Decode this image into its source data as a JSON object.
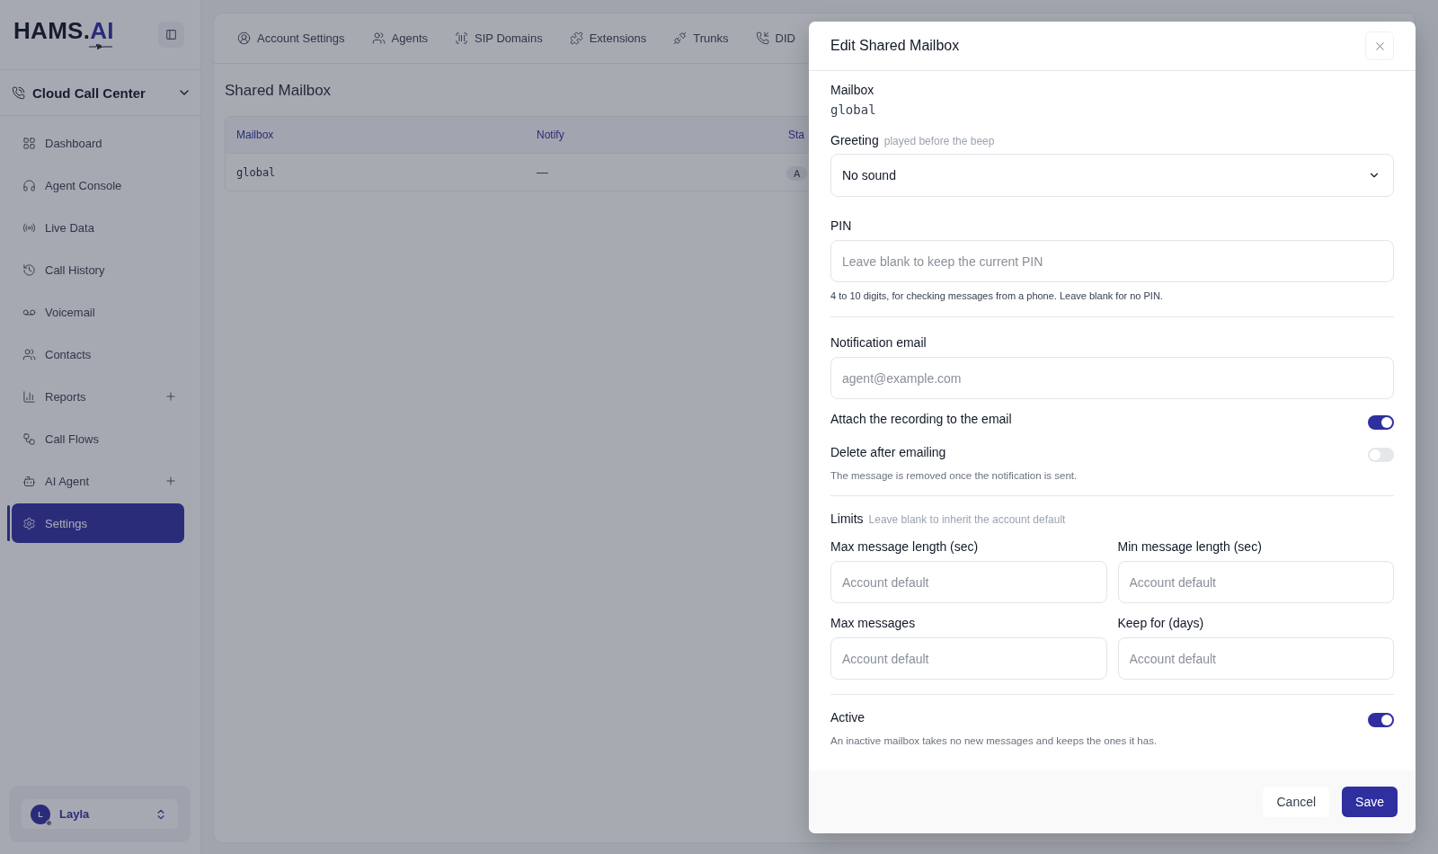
{
  "sidebar": {
    "logo": {
      "text": "HAMS.",
      "accent": "AI"
    },
    "workspace": "Cloud Call Center",
    "items": [
      {
        "label": "Dashboard",
        "selected": false,
        "addable": false
      },
      {
        "label": "Agent Console",
        "selected": false,
        "addable": false
      },
      {
        "label": "Live Data",
        "selected": false,
        "addable": false
      },
      {
        "label": "Call History",
        "selected": false,
        "addable": false
      },
      {
        "label": "Voicemail",
        "selected": false,
        "addable": false
      },
      {
        "label": "Contacts",
        "selected": false,
        "addable": false
      },
      {
        "label": "Reports",
        "selected": false,
        "addable": true
      },
      {
        "label": "Call Flows",
        "selected": false,
        "addable": false
      },
      {
        "label": "AI Agent",
        "selected": false,
        "addable": true
      },
      {
        "label": "Settings",
        "selected": true,
        "addable": false
      }
    ],
    "user": {
      "initial": "L",
      "name": "Layla"
    }
  },
  "tabs": [
    {
      "label": "Account Settings"
    },
    {
      "label": "Agents"
    },
    {
      "label": "SIP Domains"
    },
    {
      "label": "Extensions"
    },
    {
      "label": "Trunks"
    },
    {
      "label": "DID"
    }
  ],
  "page": {
    "title": "Shared Mailbox",
    "table": {
      "columns": [
        "Mailbox",
        "Notify",
        "Sta"
      ],
      "rows": [
        [
          "global",
          "—",
          "A"
        ]
      ]
    }
  },
  "dialog": {
    "title": "Edit Shared Mailbox",
    "mailbox": {
      "label": "Mailbox",
      "value": "global"
    },
    "greeting": {
      "label": "Greeting",
      "hint": "played before the beep",
      "value": "No sound"
    },
    "pin": {
      "label": "PIN",
      "placeholder": "Leave blank to keep the current PIN",
      "help": "4 to 10 digits, for checking messages from a phone. Leave blank for no PIN."
    },
    "email": {
      "label": "Notification email",
      "placeholder": "agent@example.com"
    },
    "toggles": [
      {
        "label": "Attach the recording to the email",
        "on": true
      },
      {
        "label": "Delete after emailing",
        "description": "The message is removed once the notification is sent.",
        "on": false
      }
    ],
    "limits": {
      "label": "Limits",
      "hint": "Leave blank to inherit the account default",
      "fields": [
        {
          "label": "Max message length (sec)",
          "placeholder": "Account default"
        },
        {
          "label": "Min message length (sec)",
          "placeholder": "Account default"
        },
        {
          "label": "Max messages",
          "placeholder": "Account default"
        },
        {
          "label": "Keep for (days)",
          "placeholder": "Account default"
        }
      ]
    },
    "active": {
      "label": "Active",
      "description": "An inactive mailbox takes no new messages and keeps the ones it has.",
      "on": true
    },
    "buttons": [
      {
        "label": "Cancel",
        "kind": "secondary"
      },
      {
        "label": "Save",
        "kind": "primary"
      }
    ]
  }
}
